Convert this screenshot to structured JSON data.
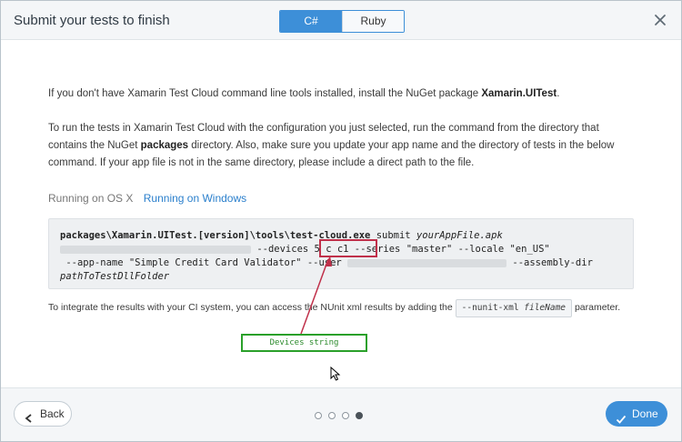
{
  "dialog": {
    "title": "Submit your tests to finish",
    "platform_tabs": [
      {
        "label": "C#",
        "active": true
      },
      {
        "label": "Ruby",
        "active": false
      }
    ]
  },
  "body": {
    "p1_text": "If you don't have Xamarin Test Cloud command line tools installed, install the NuGet package ",
    "p1_bold": "Xamarin.UITest",
    "p1_end": ".",
    "p2_a": "To run the tests in Xamarin Test Cloud with the configuration you just selected, run the command from the directory that contains the NuGet ",
    "p2_bold": "packages",
    "p2_b": " directory. Also, make sure you update your app name and the directory of tests in the below command. If your app file is not in the same directory, please include a direct path to the file."
  },
  "os_tabs": [
    {
      "label": "Running on OS X",
      "active": false
    },
    {
      "label": "Running on Windows",
      "active": true
    }
  ],
  "command": {
    "line1_bold": "packages\\Xamarin.UITest.[version]\\tools\\test-cloud.exe",
    "line1_mid": " submit ",
    "line1_it": "yourAppFile.apk",
    "line2_a": " --devices ",
    "line2_devices": "5 c c1",
    "line2_b": " --series \"master\" --locale \"en_US\"",
    "line3_a": " --app-name \"Simple Credit Card Validator\" --user ",
    "line3_b": " --assembly-dir",
    "line4_it": "pathToTestDllFolder"
  },
  "ci": {
    "text_a": "To integrate the results with your CI system, you can access the NUnit xml results by adding the ",
    "chip_code": "--nunit-xml ",
    "chip_it": "fileName",
    "text_b": " parameter."
  },
  "annotation": {
    "label": "Devices string",
    "box_color": "#2aa02a",
    "highlight_color": "#c0304a"
  },
  "footer": {
    "back_label": "Back",
    "done_label": "Done",
    "pages_total": 4,
    "current_page": 4
  },
  "colors": {
    "accent": "#3d8fd8",
    "link": "#2a7fcc"
  }
}
